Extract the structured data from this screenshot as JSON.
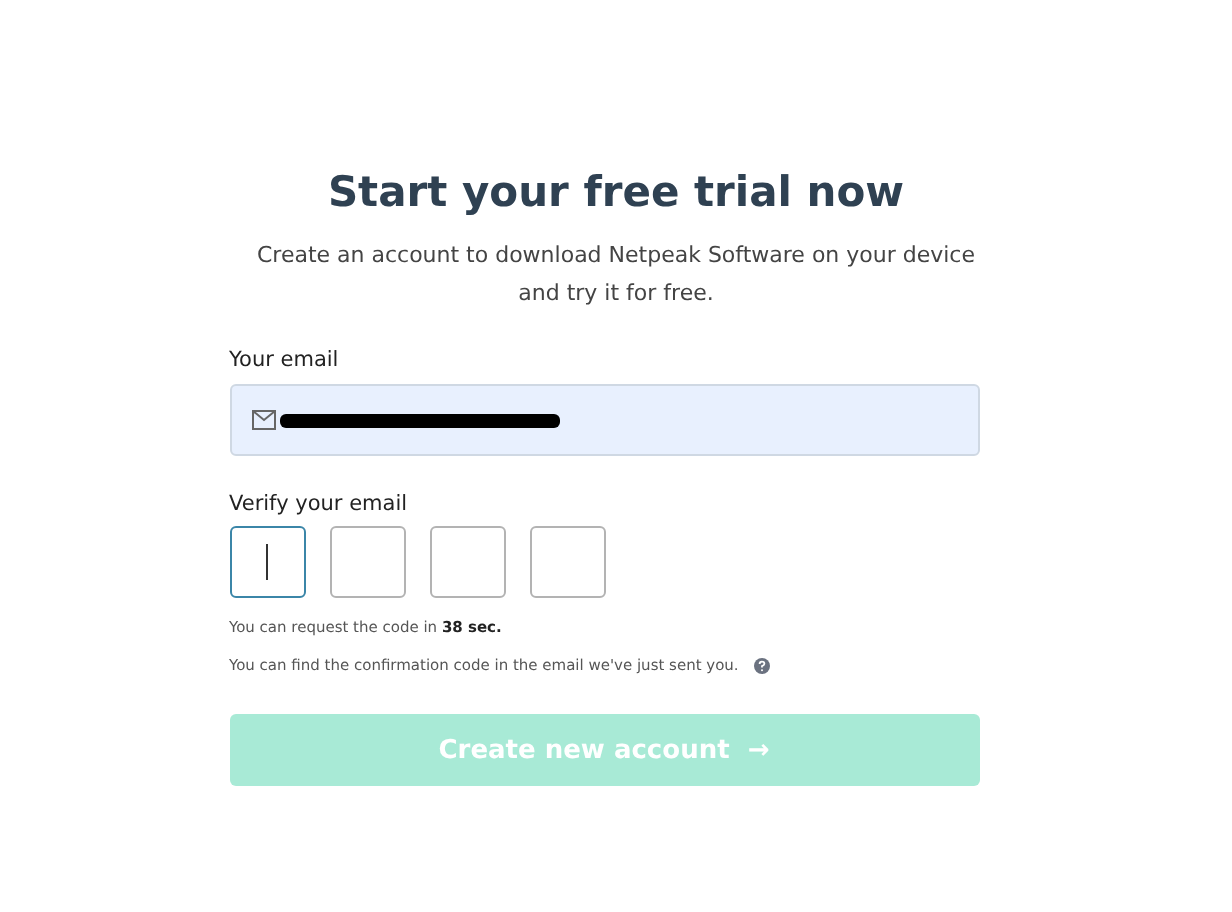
{
  "title": "Start your free trial now",
  "subtitle": "Create an account to download Netpeak Software on your device and try it for free.",
  "email": {
    "label": "Your email",
    "value_redacted": true
  },
  "verify": {
    "label": "Verify your email",
    "code_boxes": [
      {
        "selected": true
      },
      {
        "selected": false
      },
      {
        "selected": false
      },
      {
        "selected": false
      }
    ]
  },
  "resend_note": "You can request the code in **38 sec.**",
  "hint": "You can find the confirmation code in the email we've just sent you.",
  "submit": {
    "label": "Create new account",
    "arrow": "→",
    "disabled": true
  }
}
